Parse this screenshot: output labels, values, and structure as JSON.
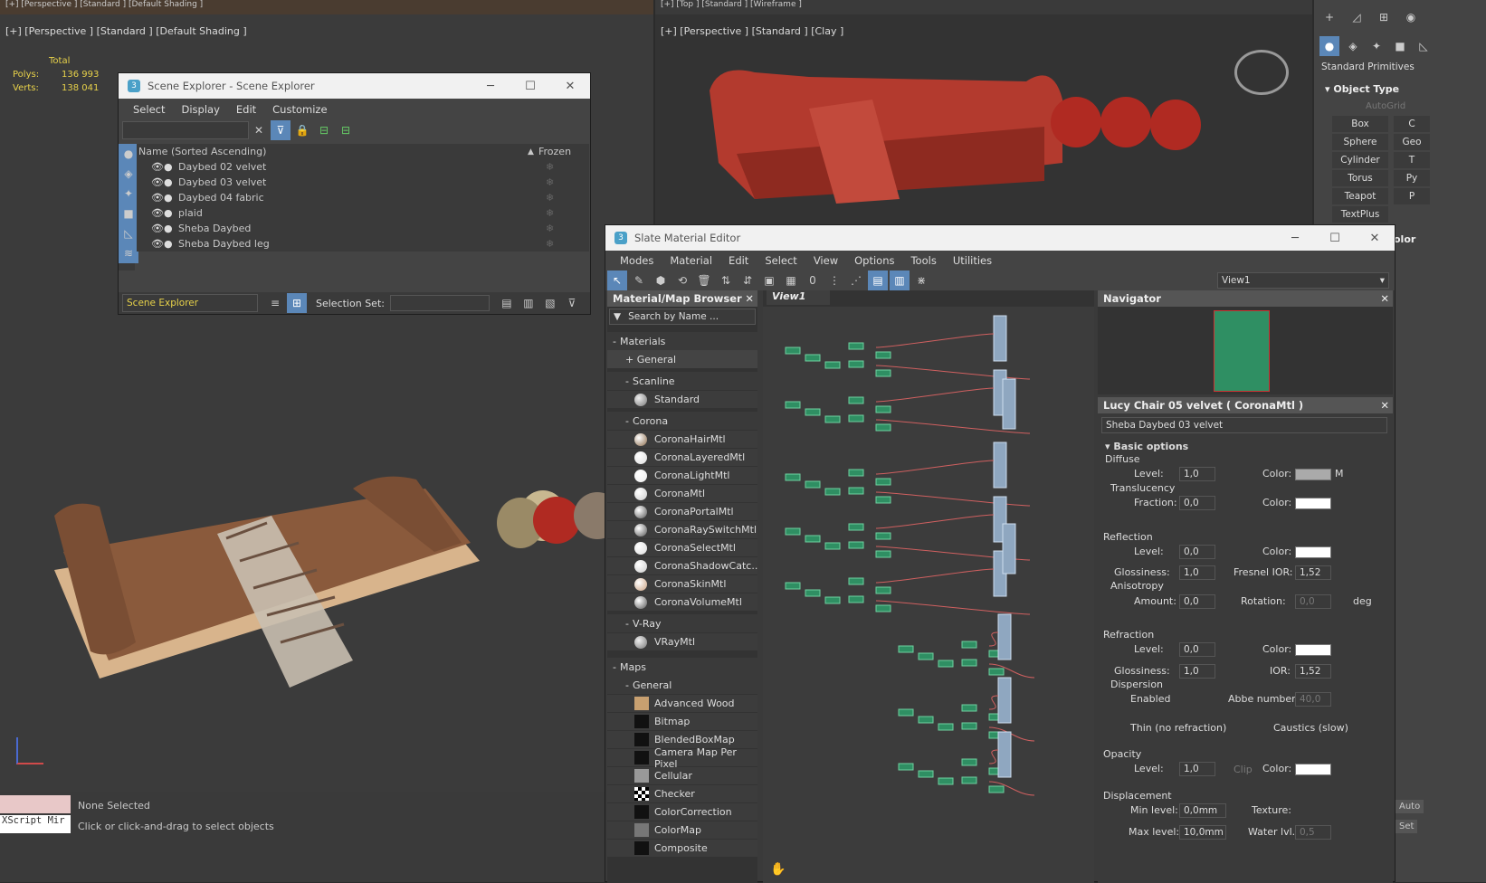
{
  "viewport_left": {
    "label": "[+] [Perspective ] [Standard ] [Default Shading ]",
    "top_strip": "[+] [Perspective ] [Standard ] [Default Shading ]",
    "stats": {
      "total": "Total",
      "polys_label": "Polys:",
      "polys": "136 993",
      "verts_label": "Verts:",
      "verts": "138 041"
    }
  },
  "viewport_right": {
    "label": "[+] [Perspective ] [Standard ] [Clay ]",
    "top_strip": "[+] [Top ] [Standard ] [Wireframe ]"
  },
  "scene_explorer": {
    "title": "Scene Explorer - Scene Explorer",
    "menu": [
      "Select",
      "Display",
      "Edit",
      "Customize"
    ],
    "col_name": "Name (Sorted Ascending)",
    "col_frozen": "Frozen",
    "sort_arrow": "▲",
    "items": [
      "Daybed 02 velvet",
      "Daybed 03 velvet",
      "Daybed 04 fabric",
      "plaid",
      "Sheba Daybed",
      "Sheba Daybed leg"
    ],
    "footer_name": "Scene Explorer",
    "selection_set": "Selection Set:"
  },
  "command_panel": {
    "category": "Standard Primitives",
    "rollout": "Object Type",
    "autogrid": "AutoGrid",
    "buttons": [
      "Box",
      "Sphere",
      "Cylinder",
      "Torus",
      "Teapot",
      "TextPlus"
    ],
    "buttons_cut": [
      "C",
      "Geo",
      "T",
      "Py",
      "P"
    ],
    "color_label": "olor"
  },
  "slate": {
    "title": "Slate Material Editor",
    "menu": [
      "Modes",
      "Material",
      "Edit",
      "Select",
      "View",
      "Options",
      "Tools",
      "Utilities"
    ],
    "view_dropdown": "View1",
    "browser": {
      "title": "Material/Map Browser",
      "search": "Search by Name ...",
      "materials": "Materials",
      "general": "+ General",
      "scanline": "Scanline",
      "standard": "Standard",
      "corona": "Corona",
      "corona_items": [
        "CoronaHairMtl",
        "CoronaLayeredMtl",
        "CoronaLightMtl",
        "CoronaMtl",
        "CoronaPortalMtl",
        "CoronaRaySwitchMtl",
        "CoronaSelectMtl",
        "CoronaShadowCatc...",
        "CoronaSkinMtl",
        "CoronaVolumeMtl"
      ],
      "vray": "V-Ray",
      "vray_items": [
        "VRayMtl"
      ],
      "maps": "Maps",
      "maps_general": "General",
      "map_items": [
        "Advanced Wood",
        "Bitmap",
        "BlendedBoxMap",
        "Camera Map Per Pixel",
        "Cellular",
        "Checker",
        "ColorCorrection",
        "ColorMap",
        "Composite"
      ]
    },
    "view_tab": "View1",
    "navigator": "Navigator",
    "params": {
      "title": "Lucy Chair 05 velvet  ( CoronaMtl )",
      "name": "Sheba Daybed 03 velvet",
      "basic": "Basic options",
      "diffuse": "Diffuse",
      "level": "Level:",
      "color": "Color:",
      "m": "M",
      "translucency": "Translucency",
      "fraction": "Fraction:",
      "reflection": "Reflection",
      "glossiness": "Glossiness:",
      "fresnel": "Fresnel IOR:",
      "anisotropy": "Anisotropy",
      "amount": "Amount:",
      "rotation": "Rotation:",
      "deg": "deg",
      "refraction": "Refraction",
      "ior": "IOR:",
      "dispersion": "Dispersion",
      "enabled": "Enabled",
      "abbe": "Abbe number:",
      "thin": "Thin (no refraction)",
      "caustics": "Caustics (slow)",
      "opacity": "Opacity",
      "clip": "Clip",
      "displacement": "Displacement",
      "min_level": "Min level:",
      "max_level": "Max level:",
      "texture": "Texture:",
      "water": "Water lvl.:",
      "v_diff_level": "1,0",
      "v_fraction": "0,0",
      "v_refl_level": "0,0",
      "v_refl_gloss": "1,0",
      "v_fresnel": "1,52",
      "v_amount": "0,0",
      "v_rotation": "0,0",
      "v_refr_level": "0,0",
      "v_refr_gloss": "1,0",
      "v_ior": "1,52",
      "v_abbe": "40,0",
      "v_op_level": "1,0",
      "v_min": "0,0mm",
      "v_max": "10,0mm",
      "v_water": "0,5"
    },
    "right_cut": [
      "Auto",
      "Set"
    ]
  },
  "status": {
    "maxscript": "XScript Mir",
    "none_selected": "None Selected",
    "hint": "Click or click-and-drag to select objects"
  },
  "colors": {
    "accent": "#5b87b8",
    "sofa_brown": "#8a5a3c",
    "sofa_red": "#b33a2e",
    "highlight_yellow": "#e8d24a"
  }
}
